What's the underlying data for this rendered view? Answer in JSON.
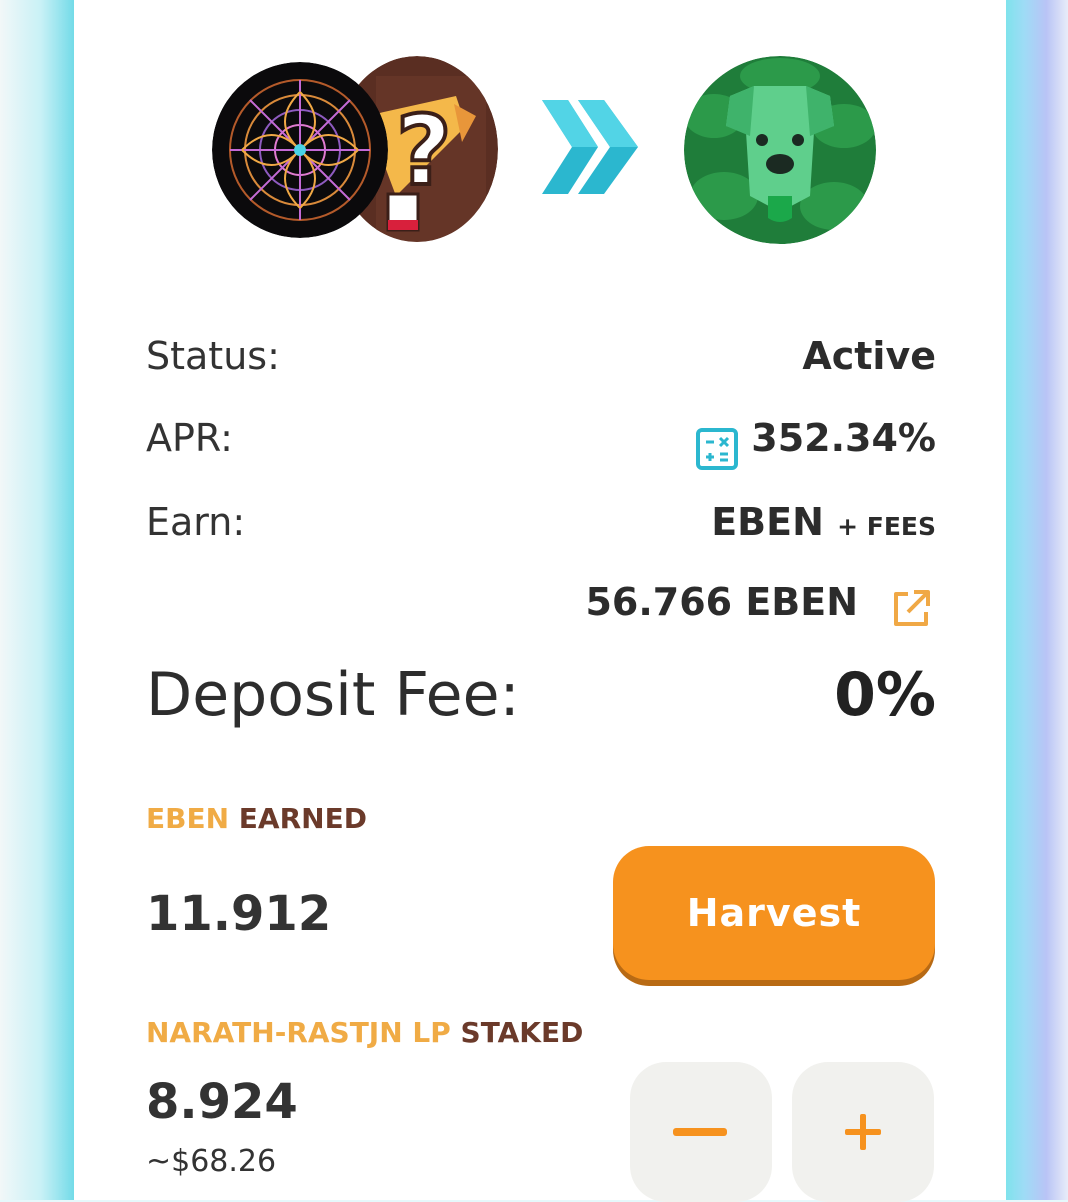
{
  "pool": {
    "tokens": {
      "lp_token_a": "mandala-token-icon",
      "lp_token_b": "question-mark-token-icon",
      "earn_token": "green-dog-token-icon",
      "arrow": "double-chevron-right-icon"
    },
    "status": {
      "label": "Status:",
      "value": "Active"
    },
    "apr": {
      "label": "APR:",
      "value": "352.34%",
      "icon": "calculator-icon"
    },
    "earn": {
      "label": "Earn:",
      "token": "EBEN",
      "fees": "+ FEES"
    },
    "earn_amount": {
      "value": "56.766",
      "token": "EBEN",
      "icon": "external-link-icon"
    },
    "deposit_fee": {
      "label": "Deposit Fee:",
      "value": "0%"
    }
  },
  "earned": {
    "token_label": "EBEN",
    "suffix": "EARNED",
    "amount": "11.912",
    "harvest_label": "Harvest"
  },
  "staked": {
    "token_label": "NARATH-RASTJN LP",
    "suffix": "STAKED",
    "amount": "8.924",
    "usd": "~$68.26",
    "minus_icon": "minus-icon",
    "plus_icon": "plus-icon"
  },
  "colors": {
    "accent_orange": "#f6921e",
    "label_orange": "#f0ab45",
    "label_brown": "#6b3a2a",
    "teal": "#2bb7cf",
    "text_dark": "#2c2c2c"
  }
}
